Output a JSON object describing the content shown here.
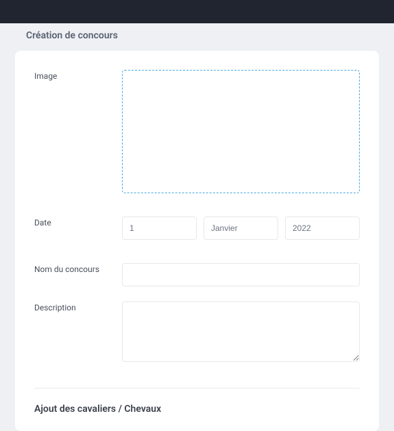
{
  "page": {
    "title": "Création de concours"
  },
  "form": {
    "image_label": "Image",
    "date_label": "Date",
    "date": {
      "day": "1",
      "month": "Janvier",
      "year": "2022"
    },
    "name_label": "Nom du concours",
    "name_value": "",
    "description_label": "Description",
    "description_value": ""
  },
  "section2": {
    "heading": "Ajout des cavaliers / Chevaux"
  }
}
